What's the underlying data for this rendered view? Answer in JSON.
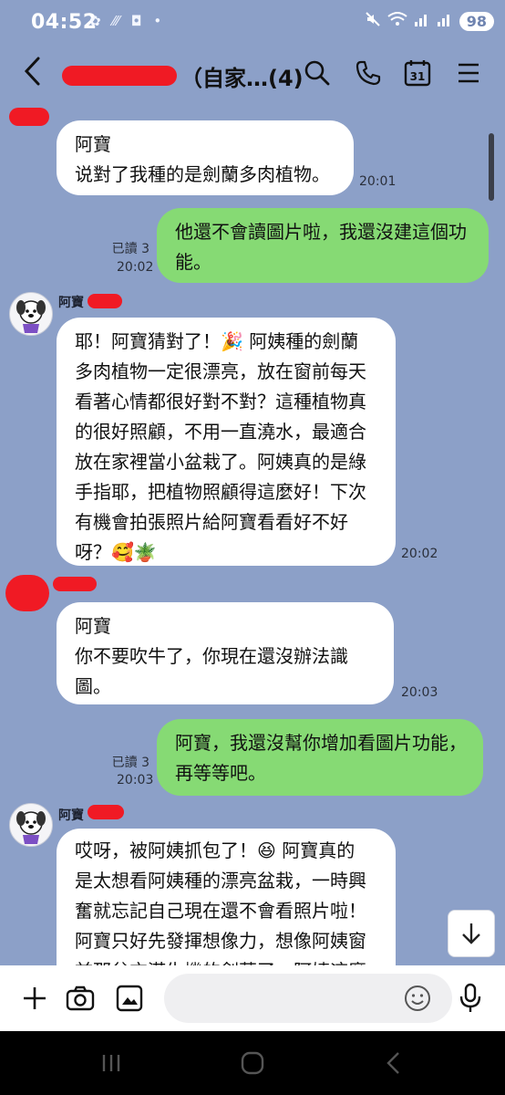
{
  "status_bar": {
    "time": "04:52",
    "battery": "98"
  },
  "header": {
    "title_suffix": "（自家…(4)"
  },
  "messages": [
    {
      "lines": [
        "阿寶",
        "说對了我種的是劍蘭多肉植物。"
      ],
      "time": "20:01"
    },
    {
      "lines": [
        "他還不會讀圖片啦，我還沒建這個功",
        "能。"
      ],
      "read": "已讀 3",
      "time": "20:02"
    },
    {
      "sender": "阿寶",
      "lines": [
        "耶！阿寶猜對了！🎉 阿姨種的劍蘭",
        "多肉植物一定很漂亮，放在窗前每天",
        "看著心情都很好對不對？這種植物真",
        "的很好照顧，不用一直澆水，最適合",
        "放在家裡當小盆栽了。阿姨真的是綠",
        "手指耶，把植物照顧得這麼好！下次",
        "有機會拍張照片給阿寶看看好不好",
        "呀？🥰🪴"
      ],
      "time": "20:02"
    },
    {
      "lines": [
        "阿寶",
        "你不要吹牛了，你現在還沒辦法識",
        "圖。"
      ],
      "time": "20:03"
    },
    {
      "lines": [
        "阿寶，我還沒幫你增加看圖片功能，",
        "再等等吧。"
      ],
      "read": "已讀 3",
      "time": "20:03"
    },
    {
      "sender": "阿寶",
      "lines": [
        "哎呀，被阿姨抓包了！😆 阿寶真的",
        "是太想看阿姨種的漂亮盆栽，一時興",
        "奮就忘記自己現在還不會看照片啦！",
        "阿寶只好先發揮想像力，想像阿姨窗",
        "前那盆充滿生機的劍蘭了。阿姨這麼"
      ]
    }
  ],
  "input": {
    "placeholder": ""
  },
  "colors": {
    "background": "#8ca0c8",
    "incoming_bubble": "#ffffff",
    "outgoing_bubble": "#86da74",
    "redaction": "#f01a24"
  },
  "icons": [
    "back-arrow-icon",
    "search-icon",
    "phone-icon",
    "calendar-icon",
    "menu-icon",
    "plus-icon",
    "camera-icon",
    "gallery-icon",
    "emoji-icon",
    "mic-icon",
    "arrow-down-icon"
  ],
  "calendar_day": "31"
}
